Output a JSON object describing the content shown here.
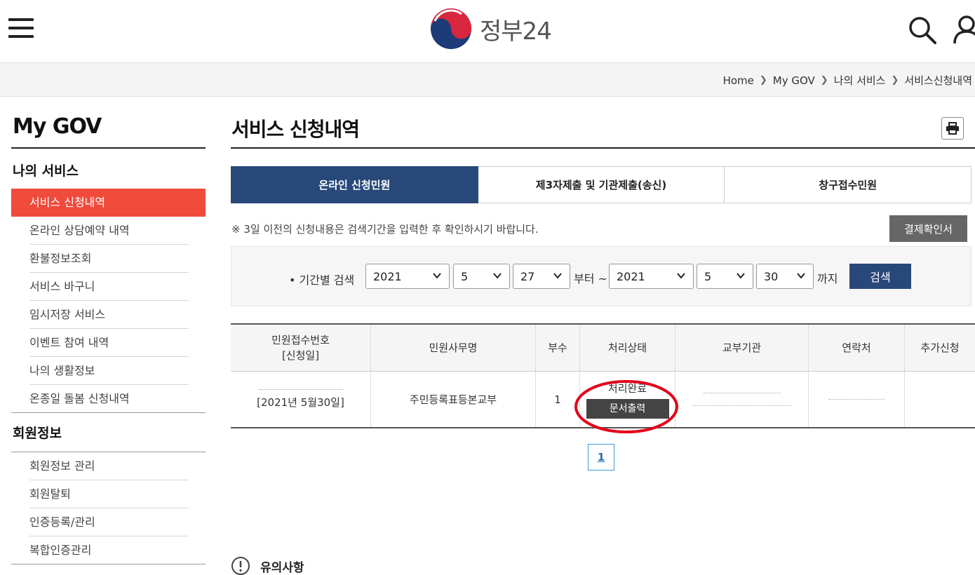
{
  "header": {
    "logo_text": "정부24",
    "menu_icon": "hamburger-menu-icon",
    "search_icon": "search-icon",
    "user_icon": "user-icon"
  },
  "breadcrumb": [
    "Home",
    "My GOV",
    "나의 서비스",
    "서비스신청내역"
  ],
  "sidebar": {
    "title": "My GOV",
    "section1": "나의 서비스",
    "items1": [
      "서비스 신청내역",
      "온라인 상담예약 내역",
      "환불정보조회",
      "서비스 바구니",
      "임시저장 서비스",
      "이벤트 참여 내역",
      "나의 생활정보",
      "온종일 돌봄 신청내역"
    ],
    "section2": "회원정보",
    "items2": [
      "회원정보 관리",
      "회원탈퇴",
      "인증등록/관리",
      "복합인증관리"
    ]
  },
  "main": {
    "title": "서비스 신청내역",
    "tabs": [
      "온라인 신청민원",
      "제3자제출 및 기관제출(송신)",
      "창구접수민원"
    ],
    "notice": "※ 3일 이전의 신청내용은 검색기간을 입력한 후 확인하시기 바랍니다.",
    "confirm_button": "결제확인서",
    "search": {
      "label": "• 기간별 검색",
      "from_year": "2021",
      "from_month": "5",
      "from_day": "27",
      "from_word": "부터 ~",
      "to_year": "2021",
      "to_month": "5",
      "to_day": "30",
      "to_word": "까지",
      "button": "검색"
    },
    "table": {
      "headers": [
        "민원접수번호",
        "[신청일]",
        "민원사무명",
        "부수",
        "처리상태",
        "교부기관",
        "연락처",
        "추가신청"
      ],
      "row": {
        "date": "[2021년 5월30일]",
        "service": "주민등록표등본교부",
        "copies": "1",
        "status": "처리완료",
        "doc_button": "문서출력"
      }
    },
    "page": "1",
    "caution": "유의사항"
  },
  "colors": {
    "accent_red": "#f04a3b",
    "tab_blue": "#28487a",
    "annotation_red": "#e3001b"
  }
}
